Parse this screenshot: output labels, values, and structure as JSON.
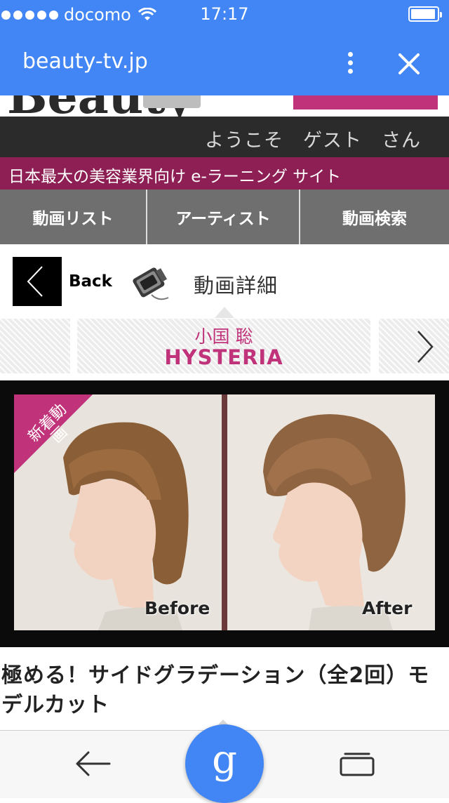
{
  "status_bar": {
    "carrier": "docomo",
    "time": "17:17"
  },
  "browser": {
    "url": "beauty-tv.jp",
    "icons": {
      "menu": "more-vert-icon",
      "close": "close-icon"
    }
  },
  "site": {
    "welcome": "ようこそ　ゲスト　さん",
    "tagline": "日本最大の美容業界向け e-ラーニング サイト",
    "nav": [
      {
        "label": "動画リスト"
      },
      {
        "label": "アーティスト"
      },
      {
        "label": "動画検索"
      }
    ],
    "detail": {
      "back_label": "Back",
      "title": "動画詳細"
    },
    "artist": {
      "name": "小国 聡",
      "salon": "HYSTERIA"
    },
    "video": {
      "badge": "新着動画",
      "before_label": "Before",
      "after_label": "After",
      "title": "極める！サイドグラデーション（全2回）モデルカット"
    },
    "colors": {
      "brand_pink": "#c0337a",
      "tagline_bg": "#8e1f55",
      "chrome_blue": "#4285f4",
      "nav_bg": "#6f6f6f"
    }
  },
  "bottom_bar": {
    "google_label": "g"
  }
}
